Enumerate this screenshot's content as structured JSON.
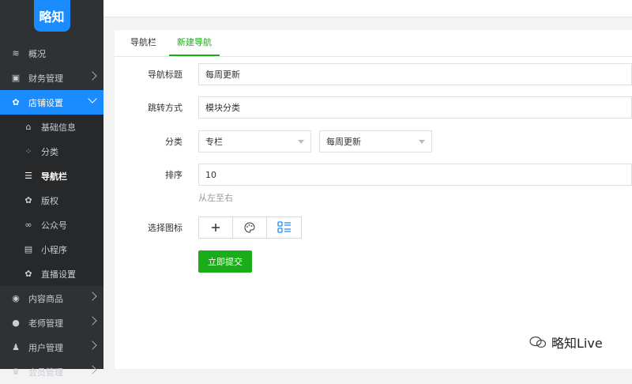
{
  "logo": {
    "text": "略知"
  },
  "sidebar": {
    "items": [
      {
        "label": "概况",
        "icon": "layers-icon",
        "glyph": "≋"
      },
      {
        "label": "财务管理",
        "icon": "finance-icon",
        "glyph": "▣"
      },
      {
        "label": "店铺设置",
        "icon": "gear-icon",
        "glyph": "✿"
      }
    ],
    "sub_items": [
      {
        "label": "基础信息",
        "icon": "home-icon",
        "glyph": "⌂"
      },
      {
        "label": "分类",
        "icon": "grid-icon",
        "glyph": "⁘"
      },
      {
        "label": "导航栏",
        "icon": "list-icon",
        "glyph": "☰"
      },
      {
        "label": "版权",
        "icon": "cog-icon",
        "glyph": "✿"
      },
      {
        "label": "公众号",
        "icon": "link-icon",
        "glyph": "∞"
      },
      {
        "label": "小程序",
        "icon": "file-icon",
        "glyph": "▤"
      },
      {
        "label": "直播设置",
        "icon": "cog-icon",
        "glyph": "✿"
      }
    ],
    "bottom_items": [
      {
        "label": "内容商品",
        "icon": "content-icon",
        "glyph": "◉"
      },
      {
        "label": "老师管理",
        "icon": "pin-icon",
        "glyph": "●"
      },
      {
        "label": "用户管理",
        "icon": "user-icon",
        "glyph": "♟"
      },
      {
        "label": "会员管理",
        "icon": "member-icon",
        "glyph": "♛"
      }
    ]
  },
  "tabs": [
    {
      "label": "导航栏"
    },
    {
      "label": "新建导航"
    }
  ],
  "form": {
    "title_label": "导航标题",
    "title_value": "每周更新",
    "jump_label": "跳转方式",
    "jump_value": "模块分类",
    "category_label": "分类",
    "category_select1": "专栏",
    "category_select2": "每周更新",
    "sort_label": "排序",
    "sort_value": "10",
    "sort_hint": "从左至右",
    "icon_label": "选择图标",
    "submit_label": "立即提交"
  },
  "colors": {
    "accent": "#1aad19",
    "sidebar_active": "#1a8cff",
    "sidebar_bg": "#2f3235"
  },
  "watermark": {
    "text": "略知Live"
  }
}
